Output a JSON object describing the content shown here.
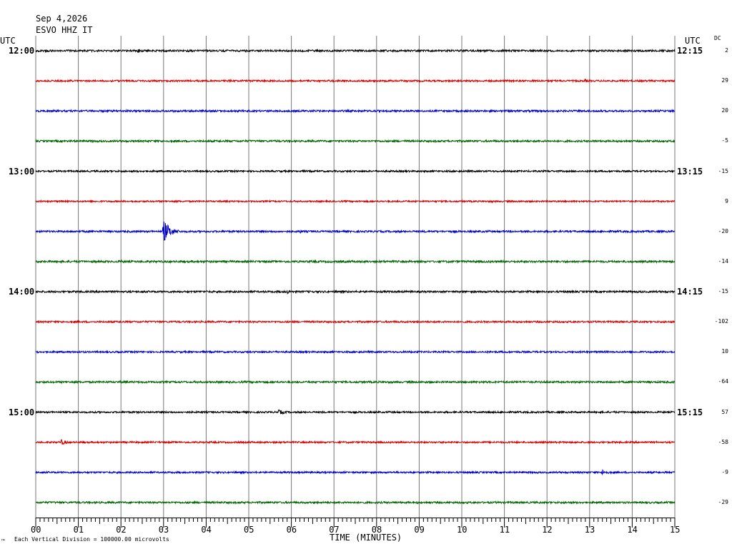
{
  "header": {
    "date": "Sep 4,2026",
    "station": "ESVO HHZ IT"
  },
  "labels": {
    "utc_left": "UTC",
    "utc_right": "UTC",
    "dc": "DC",
    "xlabel": "TIME (MINUTES)",
    "footnote": "Each Vertical Division = 100000.00 microvolts",
    "corner_mark": "™"
  },
  "chart_data": {
    "type": "line",
    "title": "",
    "xlabel": "TIME (MINUTES)",
    "ylabel": "",
    "xlim": [
      0,
      15
    ],
    "x_ticks": [
      "00",
      "01",
      "02",
      "03",
      "04",
      "05",
      "06",
      "07",
      "08",
      "09",
      "10",
      "11",
      "12",
      "13",
      "14",
      "15"
    ],
    "left_hour_labels": [
      {
        "line": 0,
        "text": "12:00"
      },
      {
        "line": 4,
        "text": "13:00"
      },
      {
        "line": 8,
        "text": "14:00"
      },
      {
        "line": 12,
        "text": "15:00"
      }
    ],
    "right_hour_labels": [
      {
        "line": 0,
        "text": "12:15"
      },
      {
        "line": 4,
        "text": "13:15"
      },
      {
        "line": 8,
        "text": "14:15"
      },
      {
        "line": 12,
        "text": "15:15"
      }
    ],
    "colors": [
      "#000000",
      "#d40000",
      "#0000cc",
      "#006600"
    ],
    "series": [
      {
        "dc": "2",
        "noise": 1.3,
        "events": [
          {
            "t": 2.4,
            "amp": 3,
            "dur": 0.3
          }
        ]
      },
      {
        "dc": "29",
        "noise": 1.2,
        "events": [
          {
            "t": 4.5,
            "amp": 3,
            "dur": 0.4
          },
          {
            "t": 12.9,
            "amp": 3,
            "dur": 0.3
          }
        ]
      },
      {
        "dc": "20",
        "noise": 1.3,
        "events": []
      },
      {
        "dc": "-5",
        "noise": 1.3,
        "events": []
      },
      {
        "dc": "-15",
        "noise": 1.2,
        "events": []
      },
      {
        "dc": "9",
        "noise": 1.1,
        "events": [
          {
            "t": 10.7,
            "amp": 2,
            "dur": 0.3
          }
        ]
      },
      {
        "dc": "-20",
        "noise": 1.3,
        "events": [
          {
            "t": 3.0,
            "amp": 16,
            "dur": 0.6
          },
          {
            "t": 6.2,
            "amp": 3,
            "dur": 0.3
          }
        ]
      },
      {
        "dc": "-14",
        "noise": 1.4,
        "events": [
          {
            "t": 2.0,
            "amp": 3,
            "dur": 0.3
          }
        ]
      },
      {
        "dc": "-15",
        "noise": 1.3,
        "events": [
          {
            "t": 5.9,
            "amp": 3,
            "dur": 0.5
          }
        ]
      },
      {
        "dc": "-102",
        "noise": 1.2,
        "events": []
      },
      {
        "dc": "10",
        "noise": 1.2,
        "events": []
      },
      {
        "dc": "-64",
        "noise": 1.3,
        "events": [
          {
            "t": 13.0,
            "amp": 2,
            "dur": 0.3
          }
        ]
      },
      {
        "dc": "57",
        "noise": 1.2,
        "events": [
          {
            "t": 5.7,
            "amp": 3.5,
            "dur": 0.8
          }
        ]
      },
      {
        "dc": "-58",
        "noise": 1.2,
        "events": [
          {
            "t": 0.6,
            "amp": 4,
            "dur": 0.6
          }
        ]
      },
      {
        "dc": "-9",
        "noise": 1.2,
        "events": [
          {
            "t": 13.3,
            "amp": 4,
            "dur": 0.6
          }
        ]
      },
      {
        "dc": "-29",
        "noise": 1.3,
        "events": []
      }
    ]
  }
}
